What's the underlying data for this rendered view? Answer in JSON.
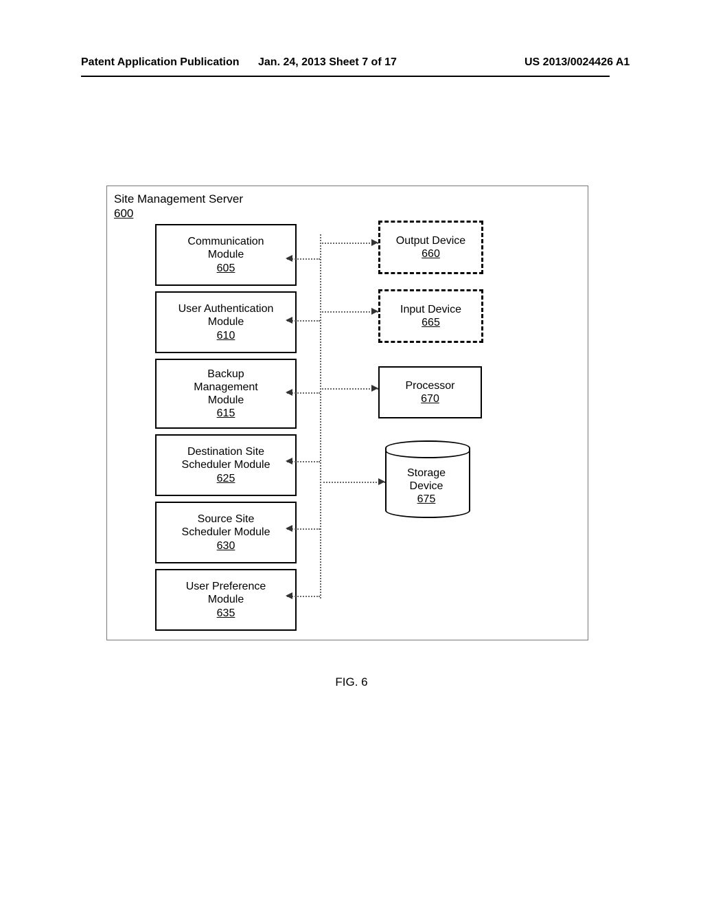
{
  "header": {
    "left": "Patent Application Publication",
    "mid": "Jan. 24, 2013  Sheet 7 of 17",
    "right": "US 2013/0024426 A1"
  },
  "container": {
    "title": "Site Management Server",
    "ref": "600"
  },
  "modules": [
    {
      "name": "Communication\nModule",
      "ref": "605"
    },
    {
      "name": "User Authentication\nModule",
      "ref": "610"
    },
    {
      "name": "Backup\nManagement\nModule",
      "ref": "615"
    },
    {
      "name": "Destination Site\nScheduler Module",
      "ref": "625"
    },
    {
      "name": "Source Site\nScheduler Module",
      "ref": "630"
    },
    {
      "name": "User Preference\nModule",
      "ref": "635"
    }
  ],
  "right_blocks": {
    "output": {
      "name": "Output Device",
      "ref": "660"
    },
    "input": {
      "name": "Input Device",
      "ref": "665"
    },
    "processor": {
      "name": "Processor",
      "ref": "670"
    },
    "storage": {
      "name": "Storage\nDevice",
      "ref": "675"
    }
  },
  "figure_caption": "FIG. 6"
}
